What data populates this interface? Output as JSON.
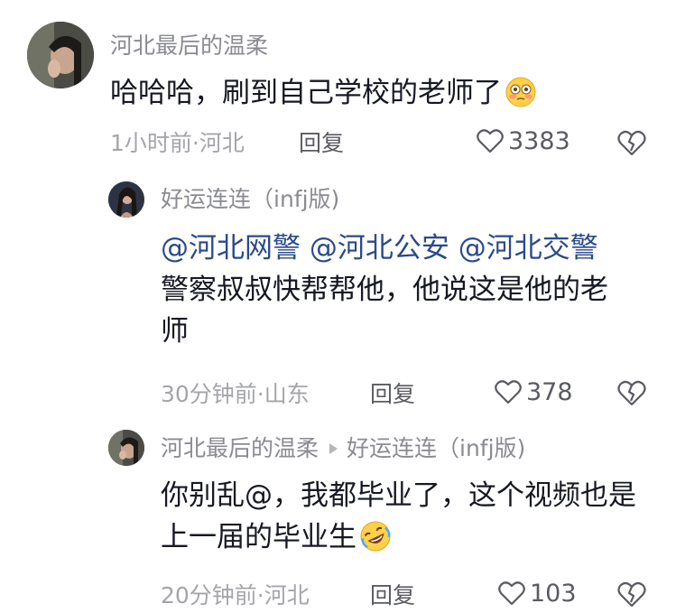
{
  "comments": [
    {
      "username": "河北最后的温柔",
      "text": "哈哈哈，刷到自己学校的老师了",
      "emoji": "flushed-face-emoji",
      "time_location": "1小时前·河北",
      "reply_label": "回复",
      "likes": "3383"
    },
    {
      "username": "好运连连（infj版)",
      "mentions": [
        "@河北网警",
        "@河北公安",
        "@河北交警"
      ],
      "text_line1_suffix": "",
      "text_rest": "警察叔叔快帮帮他，他说这是他的老师",
      "time_location": "30分钟前·山东",
      "reply_label": "回复",
      "likes": "378"
    },
    {
      "username": "河北最后的温柔",
      "reply_to": "好运连连（infj版)",
      "text": "你别乱@，我都毕业了，这个视频也是上一届的毕业生",
      "emoji": "rolling-laughing-emoji",
      "time_location": "20分钟前·河北",
      "reply_label": "回复",
      "likes": "103"
    }
  ],
  "colors": {
    "mention": "#2b4a8a",
    "meta": "#a4a5aa",
    "username": "#8a8b91",
    "text": "#161823"
  }
}
